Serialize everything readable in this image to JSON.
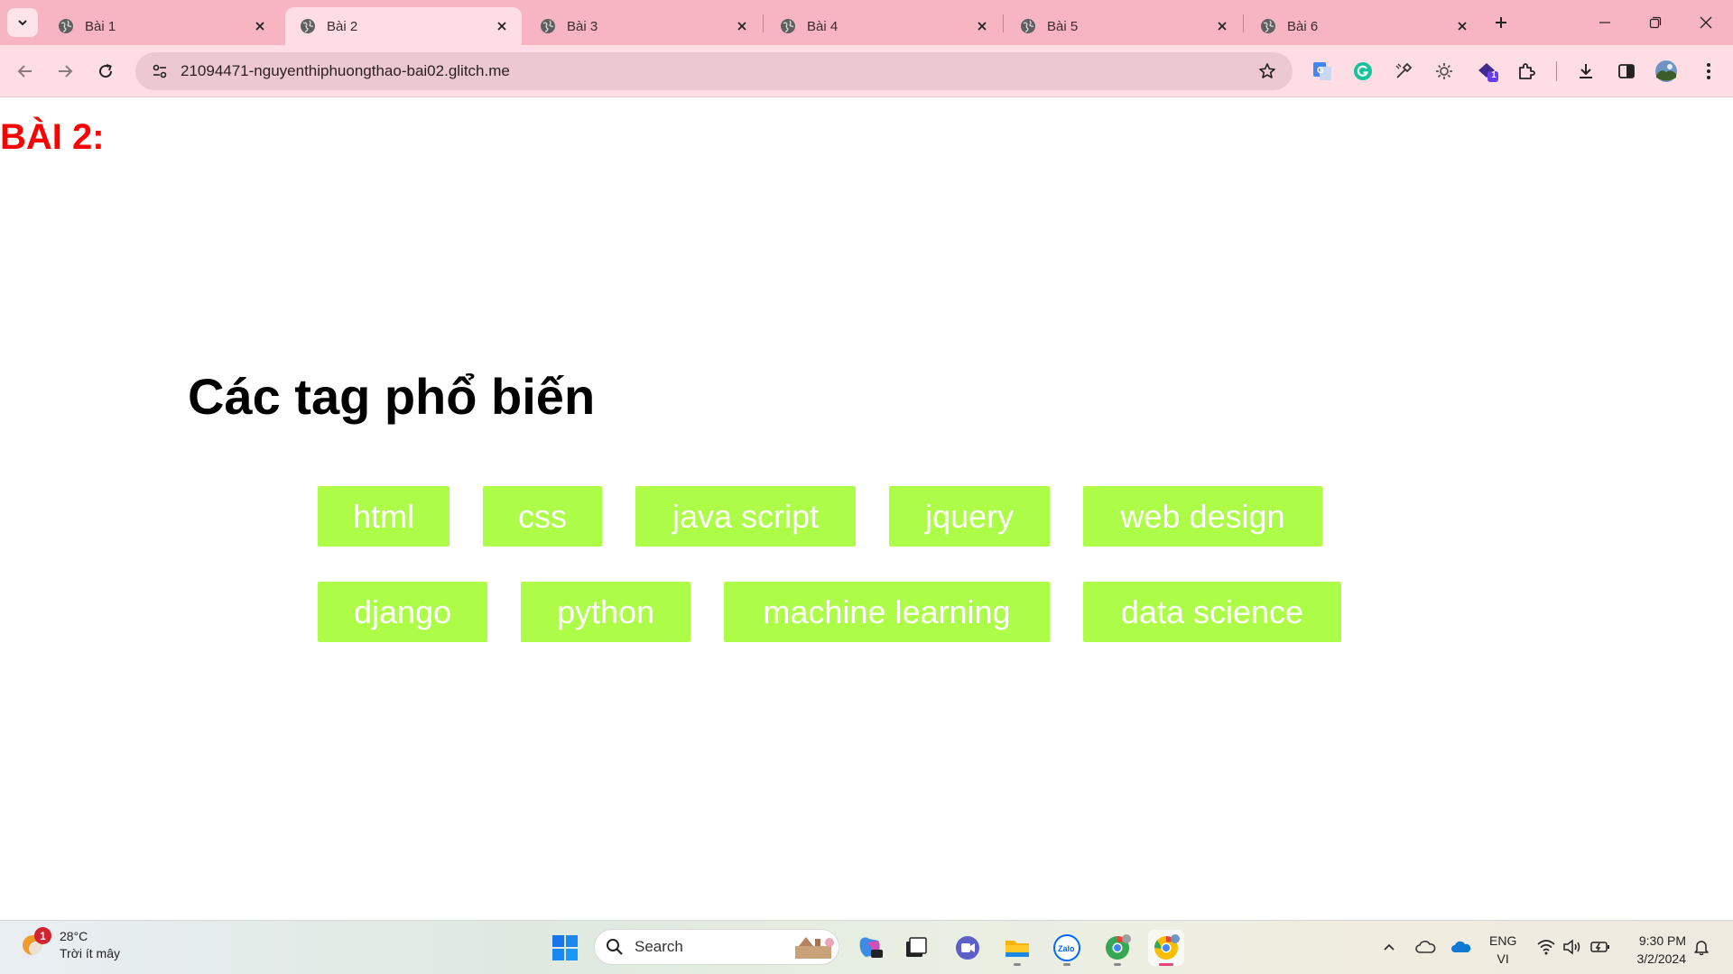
{
  "browser": {
    "tabs": [
      {
        "title": "Bài 1",
        "active": false
      },
      {
        "title": "Bài 2",
        "active": true
      },
      {
        "title": "Bài 3",
        "active": false
      },
      {
        "title": "Bài 4",
        "active": false
      },
      {
        "title": "Bài 5",
        "active": false
      },
      {
        "title": "Bài 6",
        "active": false
      }
    ],
    "url": "21094471-nguyenthiphuongthao-bai02.glitch.me",
    "extension_badge": "1"
  },
  "page": {
    "heading": "BÀI 2:",
    "section_title": "Các tag phổ biến",
    "tags_row1": [
      "html",
      "css",
      "java script",
      "jquery",
      "web design"
    ],
    "tags_row2": [
      "django",
      "python",
      "machine learning",
      "data science"
    ]
  },
  "taskbar": {
    "weather": {
      "temp": "28°C",
      "desc": "Trời ít mây",
      "badge": "1"
    },
    "search_placeholder": "Search",
    "lang_top": "ENG",
    "lang_bottom": "VI",
    "time": "9:30 PM",
    "date": "3/2/2024"
  },
  "colors": {
    "tab_strip": "#f7b5c3",
    "toolbar": "#ffdde5",
    "heading": "#ff0000",
    "tag_bg": "#adfc48"
  }
}
